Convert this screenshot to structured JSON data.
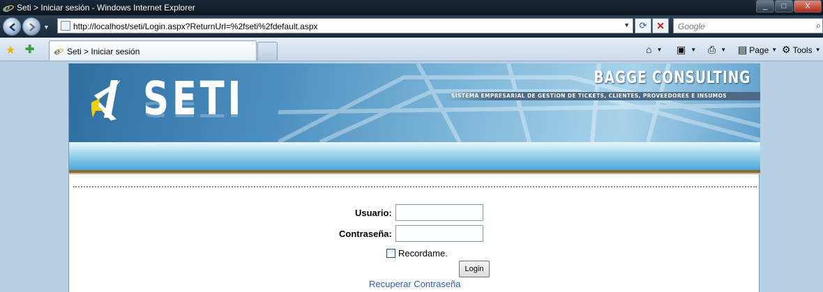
{
  "window": {
    "title": "Seti > Iniciar sesión - Windows Internet Explorer",
    "buttons": {
      "minimize": "_",
      "maximize": "□",
      "close": "X"
    }
  },
  "addressbar": {
    "url": "http://localhost/seti/Login.aspx?ReturnUrl=%2fseti%2fdefault.aspx",
    "search_placeholder": "Google"
  },
  "tabbar": {
    "tab_title": "Seti > Iniciar sesión",
    "commands": {
      "page": "Page",
      "tools": "Tools"
    }
  },
  "banner": {
    "logo_text": "SETI",
    "company": "BAGGE CONSULTING",
    "subtitle": "SISTEMA EMPRESARIAL DE GESTION DE TICKETS, CLIENTES, PROVEEDORES E INSUMOS"
  },
  "login": {
    "username_label": "Usuario:",
    "username_value": "",
    "password_label": "Contraseña:",
    "password_value": "",
    "remember_label": "Recordame.",
    "remember_checked": false,
    "login_button": "Login",
    "recover_link": "Recuperar Contraseña"
  },
  "colors": {
    "page_background": "#b8d0e4",
    "link": "#2a5db0",
    "banner_accent": "#4b8fc0",
    "separator": "#8a6a3a"
  }
}
